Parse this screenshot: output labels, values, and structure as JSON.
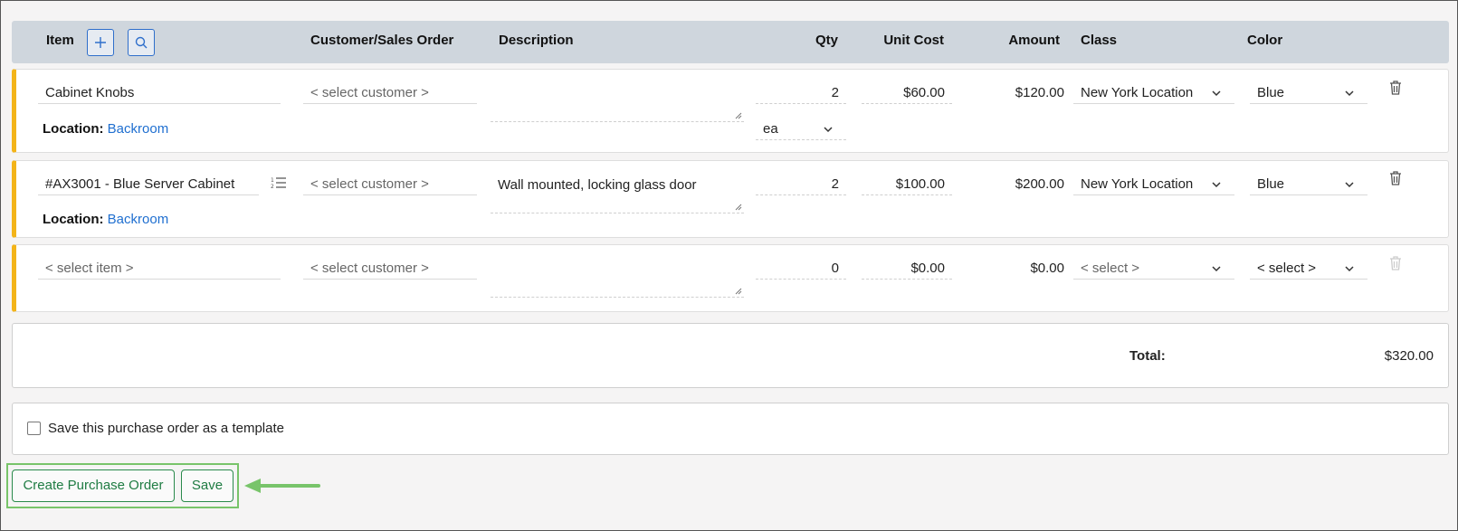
{
  "header": {
    "item": "Item",
    "customer": "Customer/Sales Order",
    "description": "Description",
    "qty": "Qty",
    "unit_cost": "Unit Cost",
    "amount": "Amount",
    "class": "Class",
    "color": "Color",
    "add_icon": "plus-icon",
    "search_icon": "search-icon"
  },
  "rows": [
    {
      "item": "Cabinet Knobs",
      "customer": "< select customer >",
      "description": "",
      "qty": "2",
      "unit": "ea",
      "unit_cost": "$60.00",
      "amount": "$120.00",
      "class": "New York Location",
      "color": "Blue",
      "location_label": "Location:",
      "location_value": "Backroom"
    },
    {
      "item": "#AX3001 - Blue Server Cabinet",
      "customer": "< select customer >",
      "description": "Wall mounted, locking glass door",
      "qty": "2",
      "unit_cost": "$100.00",
      "amount": "$200.00",
      "class": "New York Location",
      "color": "Blue",
      "location_label": "Location:",
      "location_value": "Backroom"
    },
    {
      "item": "< select item >",
      "customer": "< select customer >",
      "description": "",
      "qty": "0",
      "unit_cost": "$0.00",
      "amount": "$0.00",
      "class": "< select >",
      "color": "< select >"
    }
  ],
  "total": {
    "label": "Total:",
    "value": "$320.00"
  },
  "template_checkbox": {
    "label": "Save this purchase order as a template",
    "checked": false
  },
  "buttons": {
    "create": "Create Purchase Order",
    "save": "Save"
  },
  "colors": {
    "accent": "#f3b419",
    "link": "#1f6fd0",
    "button": "#1f7c43",
    "highlight": "#78c46a"
  }
}
